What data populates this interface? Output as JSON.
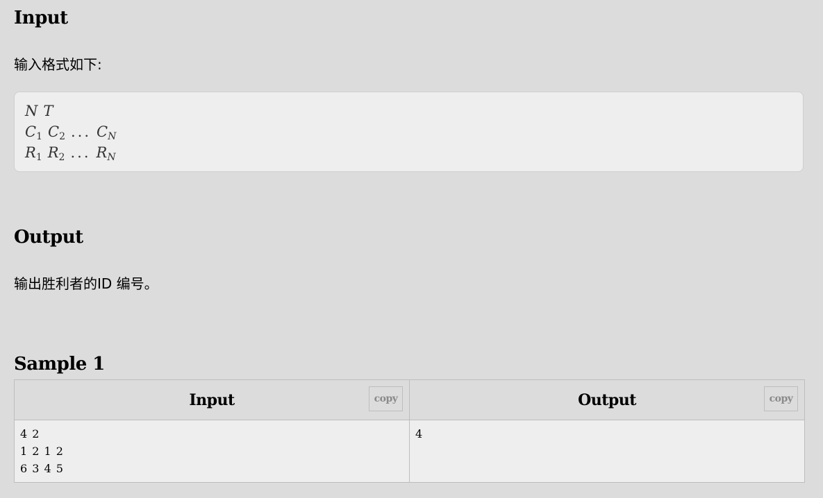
{
  "input_section": {
    "heading": "Input",
    "description": "输入格式如下:",
    "format_lines": [
      [
        "N",
        "T"
      ],
      [
        "C_1",
        "C_2",
        "...",
        "C_N"
      ],
      [
        "R_1",
        "R_2",
        "...",
        "R_N"
      ]
    ],
    "line1": {
      "a": "N",
      "b": "T"
    },
    "line2": {
      "a": "C",
      "a_sub": "1",
      "b": "C",
      "b_sub": "2",
      "dots": "...",
      "c": "C",
      "c_sub": "N"
    },
    "line3": {
      "a": "R",
      "a_sub": "1",
      "b": "R",
      "b_sub": "2",
      "dots": "...",
      "c": "R",
      "c_sub": "N"
    }
  },
  "output_section": {
    "heading": "Output",
    "description": "输出胜利者的ID 编号。"
  },
  "sample": {
    "heading": "Sample 1",
    "input_header": "Input",
    "output_header": "Output",
    "copy_label": "copy",
    "input_text": "4 2\n1 2 1 2\n6 3 4 5",
    "output_text": "4"
  }
}
